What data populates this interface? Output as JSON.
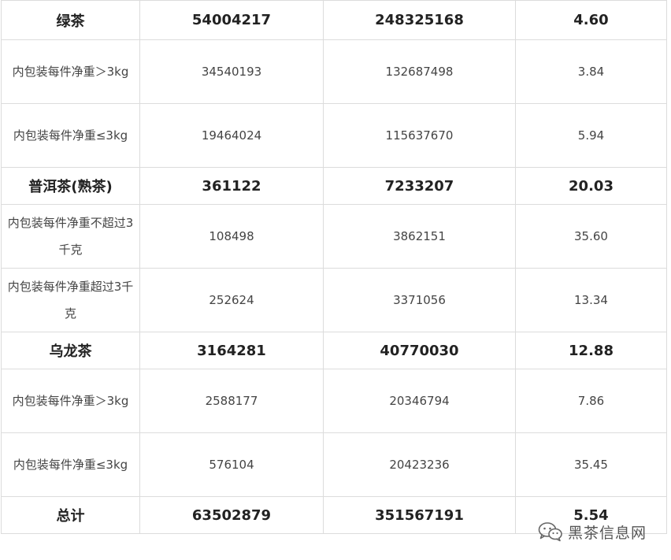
{
  "table": {
    "rows": [
      {
        "kind": "group",
        "label": "绿茶",
        "col2": "54004217",
        "col3": "248325168",
        "col4": "4.60"
      },
      {
        "kind": "sub",
        "label": "内包装每件净重＞3kg",
        "col2": "34540193",
        "col3": "132687498",
        "col4": "3.84"
      },
      {
        "kind": "sub",
        "label": "内包装每件净重≤3kg",
        "col2": "19464024",
        "col3": "115637670",
        "col4": "5.94"
      },
      {
        "kind": "group",
        "label": "普洱茶(熟茶)",
        "col2": "361122",
        "col3": "7233207",
        "col4": "20.03"
      },
      {
        "kind": "sub",
        "label": "内包装每件净重不超过3千克",
        "col2": "108498",
        "col3": "3862151",
        "col4": "35.60"
      },
      {
        "kind": "sub",
        "label": "内包装每件净重超过3千克",
        "col2": "252624",
        "col3": "3371056",
        "col4": "13.34"
      },
      {
        "kind": "group",
        "label": "乌龙茶",
        "col2": "3164281",
        "col3": "40770030",
        "col4": "12.88"
      },
      {
        "kind": "sub",
        "label": "内包装每件净重＞3kg",
        "col2": "2588177",
        "col3": "20346794",
        "col4": "7.86"
      },
      {
        "kind": "sub",
        "label": "内包装每件净重≤3kg",
        "col2": "576104",
        "col3": "20423236",
        "col4": "35.45"
      },
      {
        "kind": "group",
        "label": "总计",
        "col2": "63502879",
        "col3": "351567191",
        "col4": "5.54"
      }
    ]
  },
  "watermark": {
    "text": "黑茶信息网",
    "icon": "wechat-icon",
    "color": "#555555"
  },
  "colors": {
    "border": "#dcdcdc",
    "text": "#333333"
  }
}
